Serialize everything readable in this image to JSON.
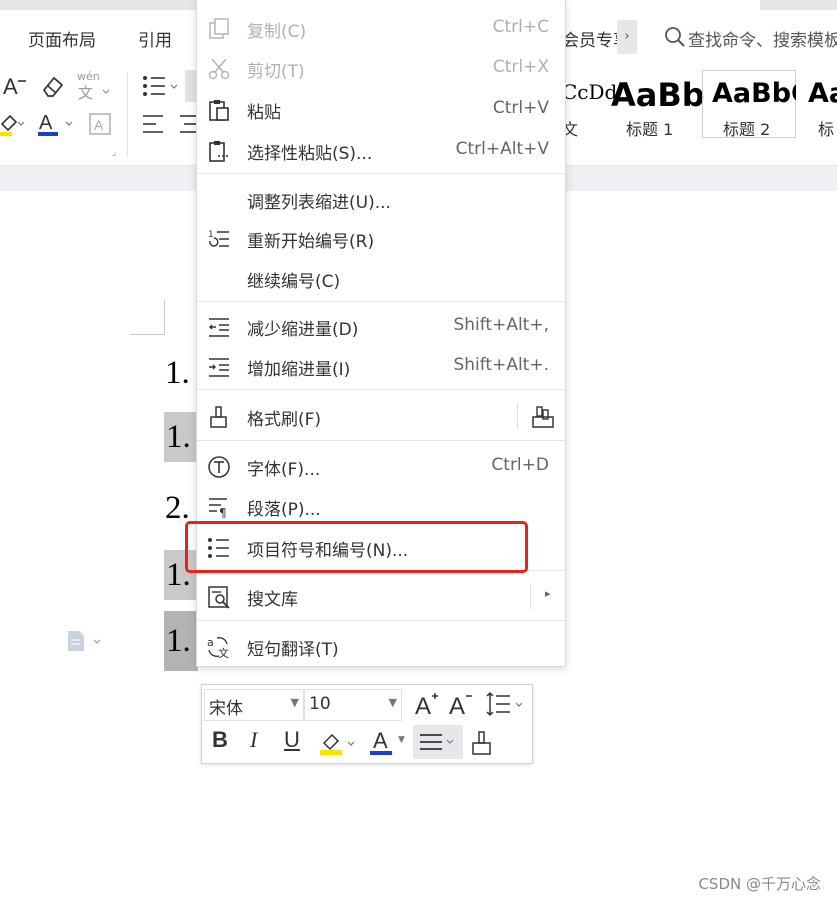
{
  "tabs": [
    "页面布局",
    "引用"
  ],
  "ribbon": {
    "member_label": "会员专享",
    "search_placeholder": "查找命令、搜索模板",
    "pinyin_label": "wén",
    "font_color_label": "A",
    "styles": [
      {
        "preview": "CcDd",
        "label": "文"
      },
      {
        "preview": "AaBb",
        "label": "标题 1"
      },
      {
        "preview": "AaBbC",
        "label": "标题 2"
      },
      {
        "preview": "Aa",
        "label": "标"
      }
    ]
  },
  "document": {
    "lines": [
      {
        "text": "1.",
        "highlight": false
      },
      {
        "text": "1.",
        "highlight": true
      },
      {
        "text": "2.",
        "highlight": false
      },
      {
        "text": "1.",
        "highlight": true
      },
      {
        "text": "1.",
        "highlight": true
      }
    ]
  },
  "context_menu": {
    "items": [
      {
        "label": "复制(C)",
        "shortcut": "Ctrl+C",
        "icon": "copy-icon",
        "disabled": true
      },
      {
        "label": "剪切(T)",
        "shortcut": "Ctrl+X",
        "icon": "scissors-icon",
        "disabled": true
      },
      {
        "label": "粘贴",
        "shortcut": "Ctrl+V",
        "icon": "paste-icon",
        "disabled": false
      },
      {
        "label": "选择性粘贴(S)...",
        "shortcut": "Ctrl+Alt+V",
        "icon": "paste-special-icon",
        "disabled": false
      },
      {
        "label": "调整列表缩进(U)...",
        "shortcut": "",
        "icon": "",
        "disabled": false
      },
      {
        "label": "重新开始编号(R)",
        "shortcut": "",
        "icon": "restart-numbering-icon",
        "disabled": false
      },
      {
        "label": "继续编号(C)",
        "shortcut": "",
        "icon": "",
        "disabled": false
      },
      {
        "label": "减少缩进量(D)",
        "shortcut": "Shift+Alt+,",
        "icon": "decrease-indent-icon",
        "disabled": false
      },
      {
        "label": "增加缩进量(I)",
        "shortcut": "Shift+Alt+.",
        "icon": "increase-indent-icon",
        "disabled": false
      },
      {
        "label": "格式刷(F)",
        "shortcut": "",
        "icon": "format-painter-icon",
        "disabled": false
      },
      {
        "label": "字体(F)...",
        "shortcut": "Ctrl+D",
        "icon": "font-icon",
        "disabled": false
      },
      {
        "label": "段落(P)...",
        "shortcut": "",
        "icon": "paragraph-icon",
        "disabled": false
      },
      {
        "label": "项目符号和编号(N)...",
        "shortcut": "",
        "icon": "bullet-list-icon",
        "disabled": false
      },
      {
        "label": "搜文库",
        "shortcut": "",
        "icon": "search-library-icon",
        "disabled": false
      },
      {
        "label": "短句翻译(T)",
        "shortcut": "",
        "icon": "translate-icon",
        "disabled": false
      }
    ]
  },
  "mini_toolbar": {
    "font_name": "宋体",
    "font_size": "10",
    "bold": "B",
    "italic": "I",
    "underline": "U",
    "font_color": "A"
  },
  "watermark": "CSDN @千万心念",
  "colors": {
    "highlight_box": "#e8231f",
    "font_color_bar": "#1a3fd1",
    "highlighter_bar": "#f5e600"
  }
}
